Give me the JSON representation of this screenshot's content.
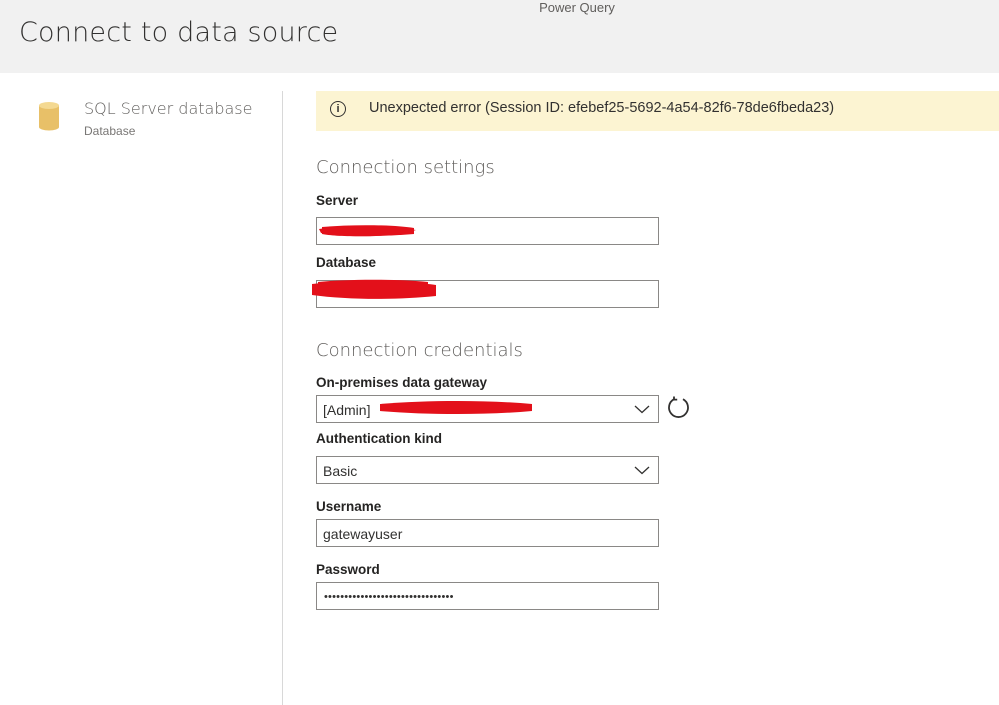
{
  "app": {
    "title": "Power Query"
  },
  "page": {
    "title": "Connect to data source"
  },
  "source": {
    "name": "SQL Server database",
    "type": "Database"
  },
  "error": {
    "icon": "info-icon",
    "message": "Unexpected error (Session ID: efebef25-5692-4a54-82f6-78de6fbeda23)"
  },
  "connection_settings": {
    "title": "Connection settings",
    "server": {
      "label": "Server",
      "value": ""
    },
    "database": {
      "label": "Database",
      "value": ""
    }
  },
  "connection_credentials": {
    "title": "Connection credentials",
    "gateway": {
      "label": "On-premises data gateway",
      "value": "[Admin]"
    },
    "auth": {
      "label": "Authentication kind",
      "value": "Basic"
    },
    "username": {
      "label": "Username",
      "value": "gatewayuser"
    },
    "password": {
      "label": "Password",
      "value": "••••••••••••••••••••••••••••••••"
    }
  },
  "colors": {
    "banner": "#fcf4d2",
    "redaction": "#e3101a",
    "header": "#f1f1f1",
    "db_icon": "#e8c068"
  }
}
